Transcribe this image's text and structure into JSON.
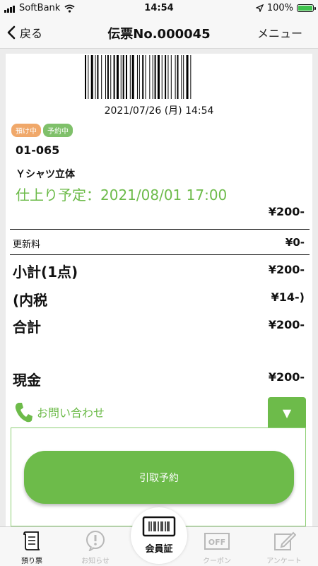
{
  "status": {
    "carrier": "SoftBank",
    "time": "14:54",
    "battery": "100%"
  },
  "nav": {
    "back_label": "戻る",
    "title": "伝票No.000045",
    "menu_label": "メニュー"
  },
  "receipt": {
    "barcode_datetime": "2021/07/26 (月) 14:54",
    "badges": [
      "預け中",
      "予約中"
    ],
    "item_code": "01-065",
    "item_name": "Ｙシャツ立体",
    "due": "仕上り予定：2021/08/01 17:00",
    "item_price": "¥200-",
    "fee_label": "更新料",
    "fee_value": "¥0-",
    "subtotal_label": "小計(1点)",
    "subtotal_value": "¥200-",
    "tax_label": "(内税",
    "tax_value": "¥14-)",
    "total_label": "合計",
    "total_value": "¥200-",
    "cash_label": "現金",
    "cash_value": "¥200-"
  },
  "inquiry": {
    "label": "お問い合わせ",
    "toggle_symbol": "▼"
  },
  "pickup": {
    "button_label": "引取予約"
  },
  "tabs": [
    {
      "label": "預り票",
      "icon": "receipt-icon",
      "active": true
    },
    {
      "label": "お知らせ",
      "icon": "notice-icon",
      "active": false
    },
    {
      "label": "会員証",
      "icon": "barcode-card-icon",
      "active": false
    },
    {
      "label": "クーポン",
      "icon": "coupon-icon",
      "active": false
    },
    {
      "label": "アンケート",
      "icon": "survey-icon",
      "active": false
    }
  ],
  "colors": {
    "accent_green": "#6dbb4a",
    "badge_orange": "#f0a86a",
    "badge_green": "#7fc06a"
  }
}
